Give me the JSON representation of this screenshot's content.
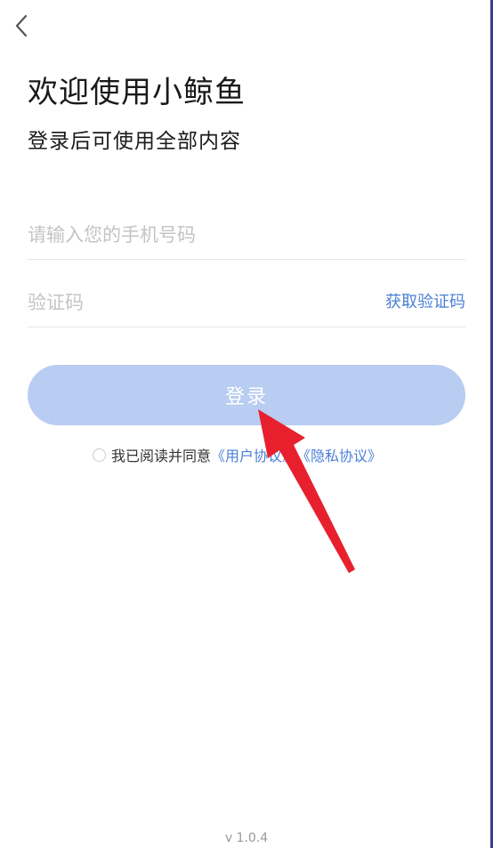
{
  "header": {
    "back_icon": "chevron-left-icon",
    "title": "欢迎使用小鲸鱼",
    "subtitle": "登录后可使用全部内容"
  },
  "form": {
    "phone": {
      "value": "",
      "placeholder": "请输入您的手机号码"
    },
    "code": {
      "value": "",
      "placeholder": "验证码",
      "get_code_label": "获取验证码"
    },
    "login_label": "登录"
  },
  "agreement": {
    "checked": false,
    "prefix": "我已阅读并同意",
    "user_agreement": "《用户协议》",
    "privacy_policy": "《隐私协议》"
  },
  "annotation": {
    "icon": "red-arrow-icon",
    "color": "#e8202e"
  },
  "footer": {
    "version": "v 1.0.4"
  },
  "colors": {
    "accent": "#4a7fd6",
    "button_disabled": "#b9ccf1",
    "placeholder": "#c4c4c4"
  }
}
